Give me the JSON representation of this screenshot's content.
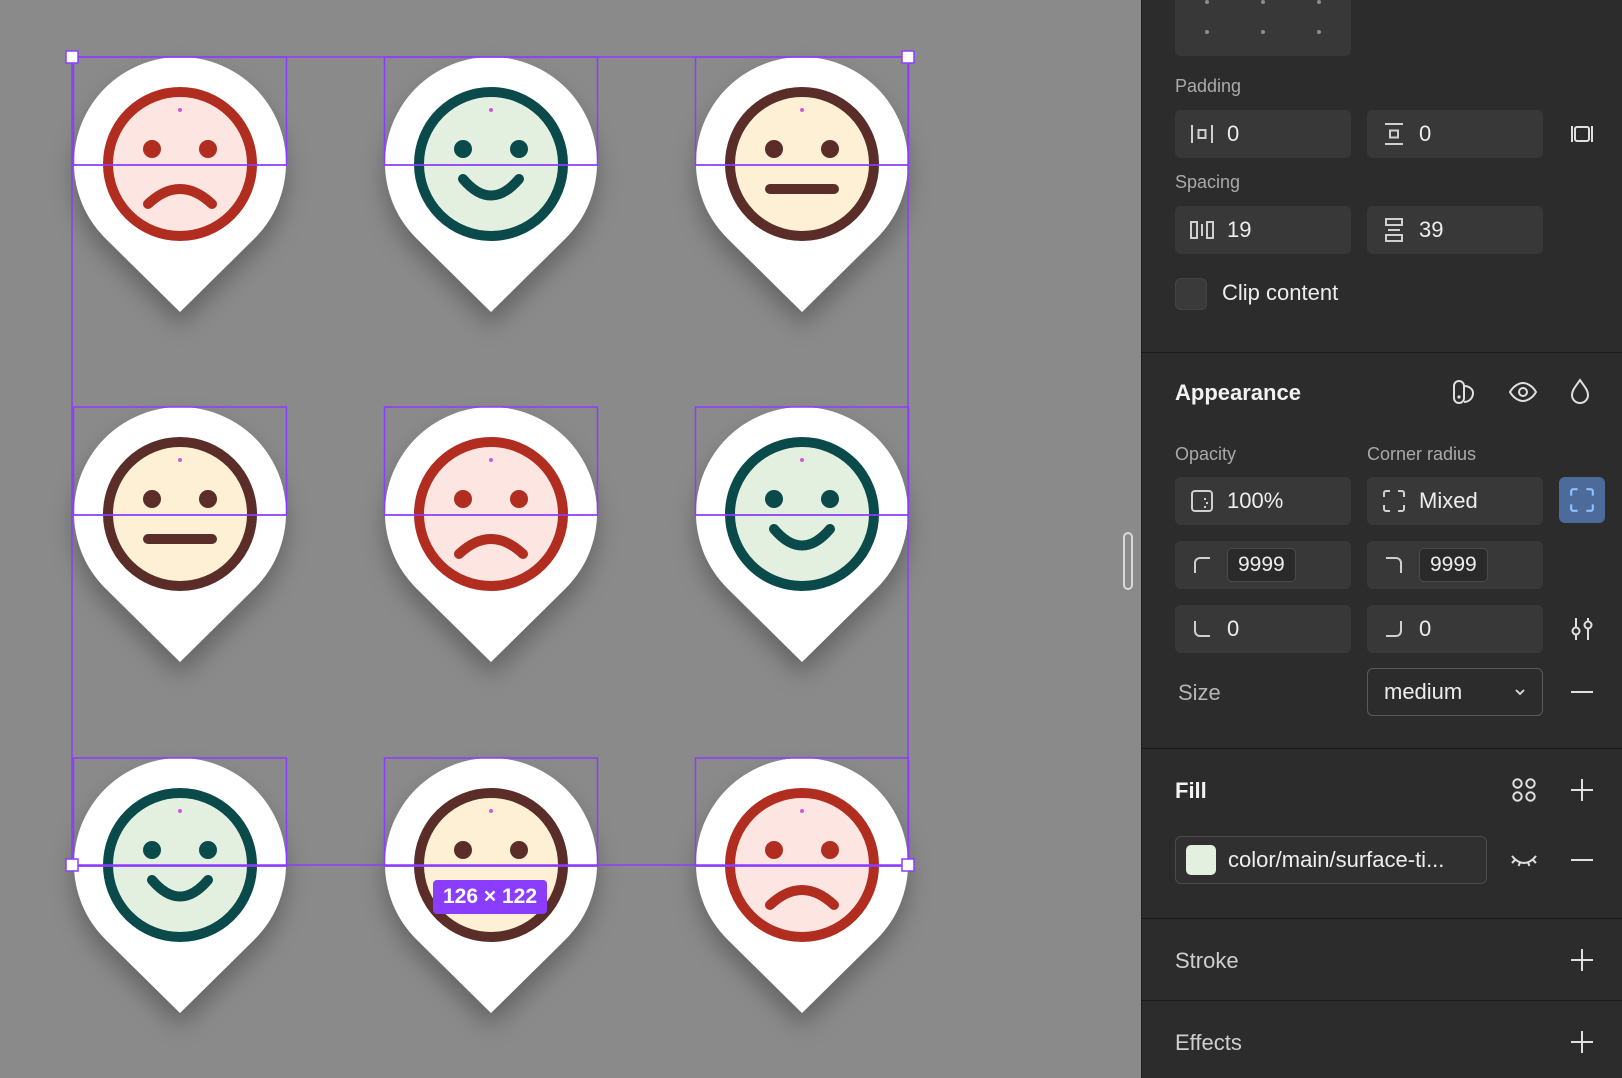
{
  "canvas": {
    "selection_size": "126 × 122",
    "accent": "#8b3dff",
    "faces": [
      {
        "mood": "sad",
        "ring": "#b02d20",
        "bg": "#fde5e1"
      },
      {
        "mood": "happy",
        "ring": "#0b4a4a",
        "bg": "#e3f0e0"
      },
      {
        "mood": "neutral",
        "ring": "#5a2d28",
        "bg": "#fdf0d4"
      },
      {
        "mood": "neutral",
        "ring": "#5a2d28",
        "bg": "#fdf0d4"
      },
      {
        "mood": "sad",
        "ring": "#b02d20",
        "bg": "#fde5e1"
      },
      {
        "mood": "happy",
        "ring": "#0b4a4a",
        "bg": "#e3f0e0"
      },
      {
        "mood": "happy",
        "ring": "#0b4a4a",
        "bg": "#e3f0e0"
      },
      {
        "mood": "neutral",
        "ring": "#5a2d28",
        "bg": "#fdf0d4"
      },
      {
        "mood": "sad",
        "ring": "#b02d20",
        "bg": "#fde5e1"
      }
    ]
  },
  "layout": {
    "padding_label": "Padding",
    "padding_horizontal": "0",
    "padding_vertical": "0",
    "spacing_label": "Spacing",
    "spacing_horizontal": "19",
    "spacing_vertical": "39",
    "clip_content_label": "Clip content"
  },
  "appearance": {
    "title": "Appearance",
    "opacity_label": "Opacity",
    "opacity_value": "100%",
    "corner_radius_label": "Corner radius",
    "corner_radius_value": "Mixed",
    "radius_top_left": "9999",
    "radius_top_right": "9999",
    "radius_bottom_left": "0",
    "radius_bottom_right": "0",
    "size_label": "Size",
    "size_value": "medium"
  },
  "fill": {
    "title": "Fill",
    "color_name": "color/main/surface-ti...",
    "swatch_color": "#e3f0e0"
  },
  "stroke": {
    "title": "Stroke"
  },
  "effects": {
    "title": "Effects"
  }
}
